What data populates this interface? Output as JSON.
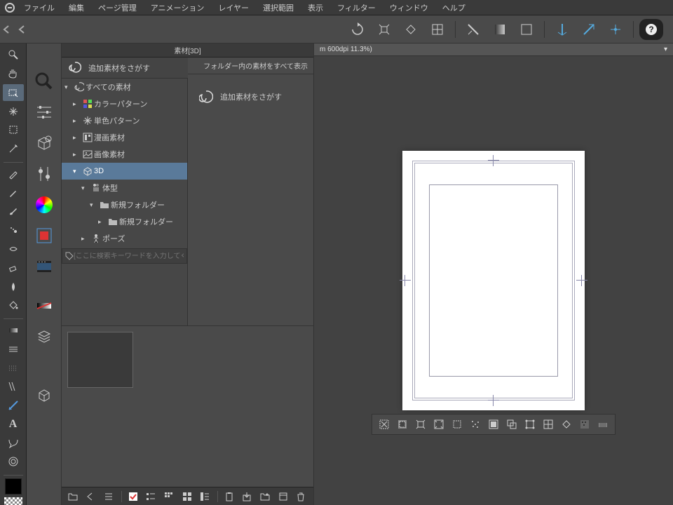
{
  "menu": {
    "items": [
      "ファイル",
      "編集",
      "ページ管理",
      "アニメーション",
      "レイヤー",
      "選択範囲",
      "表示",
      "フィルター",
      "ウィンドウ",
      "ヘルプ"
    ]
  },
  "material_panel": {
    "tab_title": "素材[3D]",
    "search_header": "追加素材をさがす",
    "show_all_label": "フォルダー内の素材をすべて表示",
    "tree": [
      {
        "label": "すべての素材",
        "icon": "spiral",
        "indent": 0,
        "expanded": true
      },
      {
        "label": "カラーパターン",
        "icon": "pattern",
        "indent": 1
      },
      {
        "label": "単色パターン",
        "icon": "mono",
        "indent": 1
      },
      {
        "label": "漫画素材",
        "icon": "manga",
        "indent": 1
      },
      {
        "label": "画像素材",
        "icon": "image",
        "indent": 1
      },
      {
        "label": "3D",
        "icon": "cube",
        "indent": 1,
        "expanded": true,
        "selected": true
      },
      {
        "label": "体型",
        "icon": "body",
        "indent": 2,
        "expanded": true
      },
      {
        "label": "新規フォルダー",
        "icon": "folder",
        "indent": 3,
        "expanded": true
      },
      {
        "label": "新規フォルダー",
        "icon": "folder",
        "indent": 4
      },
      {
        "label": "ポーズ",
        "icon": "pose",
        "indent": 2
      }
    ],
    "preview_label": "追加素材をさがす",
    "search_placeholder": "[ここに検索キーワードを入力してください]"
  },
  "canvas": {
    "info": "m 600dpi 11.3%)"
  }
}
